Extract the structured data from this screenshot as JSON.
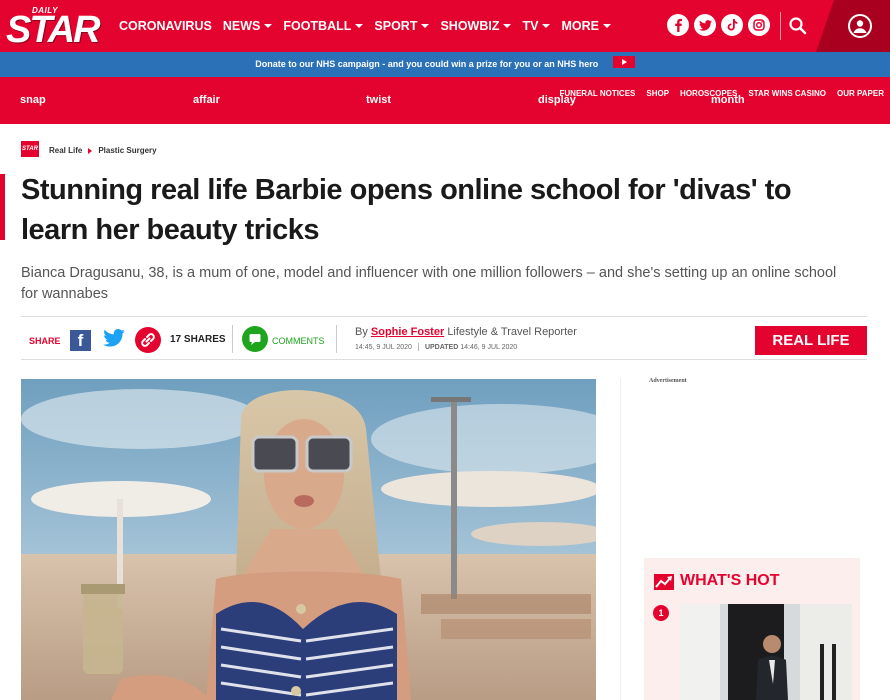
{
  "brand": {
    "daily": "DAILY",
    "star": "STAR",
    "crumb_logo": "STAR"
  },
  "nav": {
    "items": [
      {
        "label": "CORONAVIRUS",
        "caret": false
      },
      {
        "label": "NEWS",
        "caret": true
      },
      {
        "label": "FOOTBALL",
        "caret": true
      },
      {
        "label": "SPORT",
        "caret": true
      },
      {
        "label": "SHOWBIZ",
        "caret": true
      },
      {
        "label": "TV",
        "caret": true
      },
      {
        "label": "MORE",
        "caret": true
      }
    ],
    "social_icons": [
      "facebook-icon",
      "twitter-icon",
      "tiktok-icon",
      "instagram-icon"
    ]
  },
  "nhs_banner": {
    "text": "Donate to our NHS campaign - and you could win a prize for you or an NHS hero"
  },
  "subbar": {
    "links": [
      "FUNERAL NOTICES",
      "SHOP",
      "HOROSCOPES",
      "STAR WINS CASINO",
      "OUR PAPER"
    ],
    "ticker": [
      "snap",
      "affair",
      "twist",
      "display",
      "month"
    ]
  },
  "breadcrumb": {
    "items": [
      "Real Life",
      "Plastic Surgery"
    ]
  },
  "article": {
    "headline": "Stunning real life Barbie opens online school for 'divas' to learn her beauty tricks",
    "standfirst": "Bianca Dragusanu, 38, is a mum of one, model and influencer with one million followers – and she's setting up an online school for wannabes"
  },
  "share": {
    "label": "SHARE",
    "count": "17 SHARES",
    "comments_label": "COMMENTS"
  },
  "byline": {
    "prefix": "By",
    "author": "Sophie Foster",
    "role": "Lifestyle & Travel Reporter",
    "published": "14:45, 9 JUL 2020",
    "updated_label": "UPDATED",
    "updated": "14:46, 9 JUL 2020"
  },
  "section_button": {
    "label": "REAL LIFE"
  },
  "sidebar": {
    "ad_label": "Advertisement",
    "whats_hot": {
      "title": "WHAT'S HOT",
      "first_number": "1"
    }
  },
  "colors": {
    "brand_red": "#e4032e",
    "nhs_blue": "#2a71b8",
    "comments_green": "#1ea51e",
    "facebook_blue": "#3b5998"
  }
}
